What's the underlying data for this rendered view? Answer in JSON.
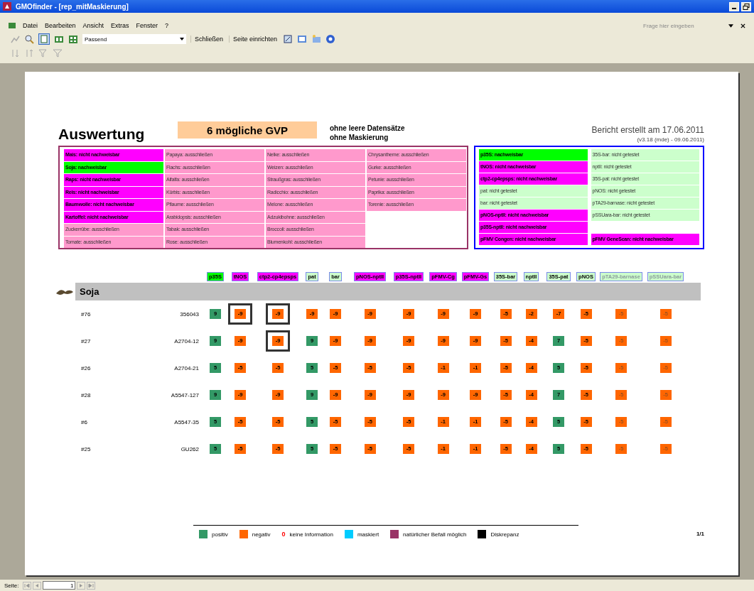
{
  "window": {
    "title": "GMOfinder - [rep_mitMaskierung]"
  },
  "menu": [
    {
      "label": "Datei"
    },
    {
      "label": "Bearbeiten"
    },
    {
      "label": "Ansicht"
    },
    {
      "label": "Extras"
    },
    {
      "label": "Fenster"
    },
    {
      "label": "?"
    }
  ],
  "help_search": {
    "placeholder": "Frage hier eingeben"
  },
  "toolbar": {
    "zoom": {
      "value": "Passend"
    },
    "buttons": [
      "Schließen",
      "Seite einrichten"
    ]
  },
  "report": {
    "title": "Auswertung",
    "highlight": "6 mögliche GVP",
    "notes": [
      "ohne leere Datensätze",
      "ohne Maskierung"
    ],
    "created": "Bericht erstellt am 17.06.2011",
    "version": "(v3.18 (mde) - 09.06.2011)",
    "species": [
      [
        {
          "text": "Mais: nicht nachweisbar",
          "kind": "finding",
          "color": "#ff00ff"
        },
        {
          "text": "Soja: nachweisbar",
          "kind": "finding",
          "color": "#00ff00"
        },
        {
          "text": "Raps: nicht nachweisbar",
          "kind": "finding",
          "color": "#ff00ff"
        },
        {
          "text": "Reis: nicht nachweisbar",
          "kind": "finding",
          "color": "#ff00ff"
        },
        {
          "text": "Baumwolle: nicht nachweisbar",
          "kind": "finding",
          "color": "#ff00ff"
        },
        {
          "text": "Kartoffel: nicht nachweisbar",
          "kind": "finding",
          "color": "#ff00ff"
        },
        {
          "text": "Zuckerrübe: ausschließen",
          "kind": "note",
          "color": "#ff99cc"
        },
        {
          "text": "Tomate: ausschließen",
          "kind": "note",
          "color": "#ff99cc"
        }
      ],
      [
        {
          "text": "Papaya: ausschließen",
          "kind": "note",
          "color": "#ff99cc"
        },
        {
          "text": "Flachs: ausschließen",
          "kind": "note",
          "color": "#ff99cc"
        },
        {
          "text": "Alfalfa: ausschließen",
          "kind": "note",
          "color": "#ff99cc"
        },
        {
          "text": "Kürbis: ausschließen",
          "kind": "note",
          "color": "#ff99cc"
        },
        {
          "text": "Pflaume: ausschließen",
          "kind": "note",
          "color": "#ff99cc"
        },
        {
          "text": "Arabidopsis: ausschließen",
          "kind": "note",
          "color": "#ff99cc"
        },
        {
          "text": "Tabak: ausschließen",
          "kind": "note",
          "color": "#ff99cc"
        },
        {
          "text": "Rose: ausschließen",
          "kind": "note",
          "color": "#ff99cc"
        }
      ],
      [
        {
          "text": "Nelke: ausschließen",
          "kind": "note",
          "color": "#ff99cc"
        },
        {
          "text": "Weizen: ausschließen",
          "kind": "note",
          "color": "#ff99cc"
        },
        {
          "text": "Straußgras: ausschließen",
          "kind": "note",
          "color": "#ff99cc"
        },
        {
          "text": "Radicchio: ausschließen",
          "kind": "note",
          "color": "#ff99cc"
        },
        {
          "text": "Melone: ausschließen",
          "kind": "note",
          "color": "#ff99cc"
        },
        {
          "text": "Adzukibohne: ausschließen",
          "kind": "note",
          "color": "#ff99cc"
        },
        {
          "text": "Broccoli: ausschließen",
          "kind": "note",
          "color": "#ff99cc"
        },
        {
          "text": "Blumenkohl: ausschließen",
          "kind": "note",
          "color": "#ff99cc"
        }
      ],
      [
        {
          "text": "Chrysantheme: ausschließen",
          "kind": "note",
          "color": "#ff99cc"
        },
        {
          "text": "Gurke: ausschließen",
          "kind": "note",
          "color": "#ff99cc"
        },
        {
          "text": "Petunie: ausschließen",
          "kind": "note",
          "color": "#ff99cc"
        },
        {
          "text": "Paprika: ausschließen",
          "kind": "note",
          "color": "#ff99cc"
        },
        {
          "text": "Torenie: ausschließen",
          "kind": "note",
          "color": "#ff99cc"
        }
      ]
    ],
    "elements": [
      [
        {
          "text": "p35S: nachweisbar",
          "kind": "finding",
          "color": "#00ff00"
        },
        {
          "text": "35S-bar: nicht getestet",
          "kind": "note",
          "color": "#ccffcc"
        }
      ],
      [
        {
          "text": "tNOS: nicht nachweisbar",
          "kind": "finding",
          "color": "#ff00ff"
        },
        {
          "text": "nptII: nicht getestet",
          "kind": "note",
          "color": "#ccffcc"
        }
      ],
      [
        {
          "text": "ctp2-cp4epsps: nicht nachweisbar",
          "kind": "finding",
          "color": "#ff00ff"
        },
        {
          "text": "35S-pat: nicht getestet",
          "kind": "note",
          "color": "#ccffcc"
        }
      ],
      [
        {
          "text": "pat: nicht getestet",
          "kind": "note",
          "color": "#ccffcc"
        },
        {
          "text": "pNOS: nicht getestet",
          "kind": "note",
          "color": "#ccffcc"
        }
      ],
      [
        {
          "text": "bar: nicht getestet",
          "kind": "note",
          "color": "#ccffcc"
        },
        {
          "text": "pTA29-barnase: nicht getestet",
          "kind": "note",
          "color": "#ccffcc"
        }
      ],
      [
        {
          "text": "pNOS-nptII: nicht nachweisbar",
          "kind": "finding",
          "color": "#ff00ff"
        },
        {
          "text": "pSSUara-bar: nicht getestet",
          "kind": "note",
          "color": "#ccffcc"
        }
      ],
      [
        {
          "text": "p35S-nptII: nicht nachweisbar",
          "kind": "finding",
          "color": "#ff00ff"
        }
      ],
      [
        {
          "text": "pFMV Congen: nicht nachweisbar",
          "kind": "finding",
          "color": "#ff00ff"
        },
        {
          "text": "pFMV GeneScan: nicht nachweisbar",
          "kind": "finding",
          "color": "#ff00ff"
        }
      ]
    ],
    "columns": [
      {
        "label": "p35S",
        "color": "#00ff00",
        "disabled": false
      },
      {
        "label": "tNOS",
        "color": "#ff00ff",
        "disabled": false
      },
      {
        "label": "ctp2-cp4epsps",
        "color": "#ff00ff",
        "disabled": false
      },
      {
        "label": "pat",
        "color": "#ccffcc",
        "disabled": false
      },
      {
        "label": "bar",
        "color": "#ccffcc",
        "disabled": false
      },
      {
        "label": "pNOS-nptII",
        "color": "#ff00ff",
        "disabled": false
      },
      {
        "label": "p35S-nptII",
        "color": "#ff00ff",
        "disabled": false
      },
      {
        "label": "pFMV-Cg",
        "color": "#ff00ff",
        "disabled": false
      },
      {
        "label": "pFMV-Gs",
        "color": "#ff00ff",
        "disabled": false
      },
      {
        "label": "35S-bar",
        "color": "#ccffcc",
        "disabled": false
      },
      {
        "label": "nptII",
        "color": "#ccffcc",
        "disabled": false
      },
      {
        "label": "35S-pat",
        "color": "#ccffcc",
        "disabled": false
      },
      {
        "label": "pNOS",
        "color": "#ccffcc",
        "disabled": false
      },
      {
        "label": "pTA29-barnase",
        "color": "#ccffcc",
        "disabled": true
      },
      {
        "label": "pSSUara-bar",
        "color": "#ccffcc",
        "disabled": true
      }
    ],
    "group": {
      "label": "Soja"
    },
    "rows": [
      {
        "id": "#76",
        "sample": "356043",
        "cells": [
          {
            "value": "9",
            "color": "#339966",
            "discrepancy": false
          },
          {
            "value": "-9",
            "color": "#ff6600",
            "discrepancy": true
          },
          {
            "value": "-9",
            "color": "#ff6600",
            "discrepancy": true
          },
          {
            "value": "-9",
            "color": "#ff6600",
            "discrepancy": false
          },
          {
            "value": "-9",
            "color": "#ff6600",
            "discrepancy": false
          },
          {
            "value": "-9",
            "color": "#ff6600",
            "discrepancy": false
          },
          {
            "value": "-9",
            "color": "#ff6600",
            "discrepancy": false
          },
          {
            "value": "-9",
            "color": "#ff6600",
            "discrepancy": false
          },
          {
            "value": "-9",
            "color": "#ff6600",
            "discrepancy": false
          },
          {
            "value": "-5",
            "color": "#ff6600",
            "discrepancy": false
          },
          {
            "value": "-2",
            "color": "#ff6600",
            "discrepancy": false
          },
          {
            "value": "-7",
            "color": "#ff6600",
            "discrepancy": false
          },
          {
            "value": "-5",
            "color": "#ff6600",
            "discrepancy": false
          },
          {
            "value": "-5",
            "color": "#ff6600",
            "discrepancy": false
          },
          {
            "value": "-5",
            "color": "#ff6600",
            "discrepancy": false
          }
        ]
      },
      {
        "id": "#27",
        "sample": "A2704-12",
        "cells": [
          {
            "value": "9",
            "color": "#339966",
            "discrepancy": false
          },
          {
            "value": "-9",
            "color": "#ff6600",
            "discrepancy": false
          },
          {
            "value": "-9",
            "color": "#ff6600",
            "discrepancy": true
          },
          {
            "value": "9",
            "color": "#339966",
            "discrepancy": false
          },
          {
            "value": "-9",
            "color": "#ff6600",
            "discrepancy": false
          },
          {
            "value": "-9",
            "color": "#ff6600",
            "discrepancy": false
          },
          {
            "value": "-9",
            "color": "#ff6600",
            "discrepancy": false
          },
          {
            "value": "-9",
            "color": "#ff6600",
            "discrepancy": false
          },
          {
            "value": "-9",
            "color": "#ff6600",
            "discrepancy": false
          },
          {
            "value": "-5",
            "color": "#ff6600",
            "discrepancy": false
          },
          {
            "value": "-4",
            "color": "#ff6600",
            "discrepancy": false
          },
          {
            "value": "7",
            "color": "#339966",
            "discrepancy": false
          },
          {
            "value": "-5",
            "color": "#ff6600",
            "discrepancy": false
          },
          {
            "value": "-5",
            "color": "#ff6600",
            "discrepancy": false
          },
          {
            "value": "-5",
            "color": "#ff6600",
            "discrepancy": false
          }
        ]
      },
      {
        "id": "#26",
        "sample": "A2704-21",
        "cells": [
          {
            "value": "5",
            "color": "#339966",
            "discrepancy": false
          },
          {
            "value": "-5",
            "color": "#ff6600",
            "discrepancy": false
          },
          {
            "value": "-5",
            "color": "#ff6600",
            "discrepancy": false
          },
          {
            "value": "5",
            "color": "#339966",
            "discrepancy": false
          },
          {
            "value": "-5",
            "color": "#ff6600",
            "discrepancy": false
          },
          {
            "value": "-5",
            "color": "#ff6600",
            "discrepancy": false
          },
          {
            "value": "-5",
            "color": "#ff6600",
            "discrepancy": false
          },
          {
            "value": "-1",
            "color": "#ff6600",
            "discrepancy": false
          },
          {
            "value": "-1",
            "color": "#ff6600",
            "discrepancy": false
          },
          {
            "value": "-5",
            "color": "#ff6600",
            "discrepancy": false
          },
          {
            "value": "-4",
            "color": "#ff6600",
            "discrepancy": false
          },
          {
            "value": "5",
            "color": "#339966",
            "discrepancy": false
          },
          {
            "value": "-5",
            "color": "#ff6600",
            "discrepancy": false
          },
          {
            "value": "-5",
            "color": "#ff6600",
            "discrepancy": false
          },
          {
            "value": "-5",
            "color": "#ff6600",
            "discrepancy": false
          }
        ]
      },
      {
        "id": "#28",
        "sample": "A5547-127",
        "cells": [
          {
            "value": "9",
            "color": "#339966",
            "discrepancy": false
          },
          {
            "value": "-9",
            "color": "#ff6600",
            "discrepancy": false
          },
          {
            "value": "-9",
            "color": "#ff6600",
            "discrepancy": false
          },
          {
            "value": "9",
            "color": "#339966",
            "discrepancy": false
          },
          {
            "value": "-9",
            "color": "#ff6600",
            "discrepancy": false
          },
          {
            "value": "-9",
            "color": "#ff6600",
            "discrepancy": false
          },
          {
            "value": "-9",
            "color": "#ff6600",
            "discrepancy": false
          },
          {
            "value": "-9",
            "color": "#ff6600",
            "discrepancy": false
          },
          {
            "value": "-9",
            "color": "#ff6600",
            "discrepancy": false
          },
          {
            "value": "-5",
            "color": "#ff6600",
            "discrepancy": false
          },
          {
            "value": "-4",
            "color": "#ff6600",
            "discrepancy": false
          },
          {
            "value": "7",
            "color": "#339966",
            "discrepancy": false
          },
          {
            "value": "-5",
            "color": "#ff6600",
            "discrepancy": false
          },
          {
            "value": "-5",
            "color": "#ff6600",
            "discrepancy": false
          },
          {
            "value": "-5",
            "color": "#ff6600",
            "discrepancy": false
          }
        ]
      },
      {
        "id": "#6",
        "sample": "A5547-35",
        "cells": [
          {
            "value": "5",
            "color": "#339966",
            "discrepancy": false
          },
          {
            "value": "-5",
            "color": "#ff6600",
            "discrepancy": false
          },
          {
            "value": "-5",
            "color": "#ff6600",
            "discrepancy": false
          },
          {
            "value": "5",
            "color": "#339966",
            "discrepancy": false
          },
          {
            "value": "-5",
            "color": "#ff6600",
            "discrepancy": false
          },
          {
            "value": "-5",
            "color": "#ff6600",
            "discrepancy": false
          },
          {
            "value": "-5",
            "color": "#ff6600",
            "discrepancy": false
          },
          {
            "value": "-1",
            "color": "#ff6600",
            "discrepancy": false
          },
          {
            "value": "-1",
            "color": "#ff6600",
            "discrepancy": false
          },
          {
            "value": "-5",
            "color": "#ff6600",
            "discrepancy": false
          },
          {
            "value": "-4",
            "color": "#ff6600",
            "discrepancy": false
          },
          {
            "value": "5",
            "color": "#339966",
            "discrepancy": false
          },
          {
            "value": "-5",
            "color": "#ff6600",
            "discrepancy": false
          },
          {
            "value": "-5",
            "color": "#ff6600",
            "discrepancy": false
          },
          {
            "value": "-5",
            "color": "#ff6600",
            "discrepancy": false
          }
        ]
      },
      {
        "id": "#25",
        "sample": "GU262",
        "cells": [
          {
            "value": "5",
            "color": "#339966",
            "discrepancy": false
          },
          {
            "value": "-5",
            "color": "#ff6600",
            "discrepancy": false
          },
          {
            "value": "-5",
            "color": "#ff6600",
            "discrepancy": false
          },
          {
            "value": "5",
            "color": "#339966",
            "discrepancy": false
          },
          {
            "value": "-5",
            "color": "#ff6600",
            "discrepancy": false
          },
          {
            "value": "-5",
            "color": "#ff6600",
            "discrepancy": false
          },
          {
            "value": "-5",
            "color": "#ff6600",
            "discrepancy": false
          },
          {
            "value": "-1",
            "color": "#ff6600",
            "discrepancy": false
          },
          {
            "value": "-1",
            "color": "#ff6600",
            "discrepancy": false
          },
          {
            "value": "-5",
            "color": "#ff6600",
            "discrepancy": false
          },
          {
            "value": "-4",
            "color": "#ff6600",
            "discrepancy": false
          },
          {
            "value": "5",
            "color": "#339966",
            "discrepancy": false
          },
          {
            "value": "-5",
            "color": "#ff6600",
            "discrepancy": false
          },
          {
            "value": "-5",
            "color": "#ff6600",
            "discrepancy": false
          },
          {
            "value": "-5",
            "color": "#ff6600",
            "discrepancy": false
          }
        ]
      }
    ],
    "legend": [
      {
        "kind": "swatch",
        "color": "#339966",
        "label": "positiv"
      },
      {
        "kind": "swatch",
        "color": "#ff6600",
        "label": "negativ"
      },
      {
        "kind": "symbol",
        "symbol": "0",
        "color": "#ff0000",
        "label": "keine Information"
      },
      {
        "kind": "swatch",
        "color": "#00ccff",
        "label": "maskiert"
      },
      {
        "kind": "swatch",
        "color": "#993366",
        "label": "natürlicher Befall möglich"
      },
      {
        "kind": "swatch",
        "color": "#000000",
        "label": "Diskrepanz"
      }
    ],
    "page_count": "1/1"
  },
  "navigation": {
    "label": "Seite:",
    "page": "1"
  }
}
